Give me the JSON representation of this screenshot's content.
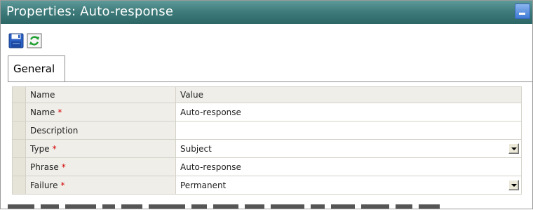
{
  "window": {
    "title": "Properties: Auto-response"
  },
  "toolbar": {
    "save_icon": "floppy-disk",
    "refresh_icon": "green-refresh-arrows"
  },
  "tabs": [
    {
      "label": "General"
    }
  ],
  "grid": {
    "headers": {
      "name": "Name",
      "value": "Value"
    },
    "required_marker": "*",
    "rows": [
      {
        "name": "Name",
        "required": true,
        "value": "Auto-response",
        "type": "text"
      },
      {
        "name": "Description",
        "required": false,
        "value": "",
        "type": "text"
      },
      {
        "name": "Type",
        "required": true,
        "value": "Subject",
        "type": "select"
      },
      {
        "name": "Phrase",
        "required": true,
        "value": "Auto-response",
        "type": "text"
      },
      {
        "name": "Failure",
        "required": true,
        "value": "Permanent",
        "type": "select"
      }
    ]
  },
  "colors": {
    "titlebar": "#3f7c7b",
    "required": "#d40000",
    "grid_header": "#efeee9"
  }
}
